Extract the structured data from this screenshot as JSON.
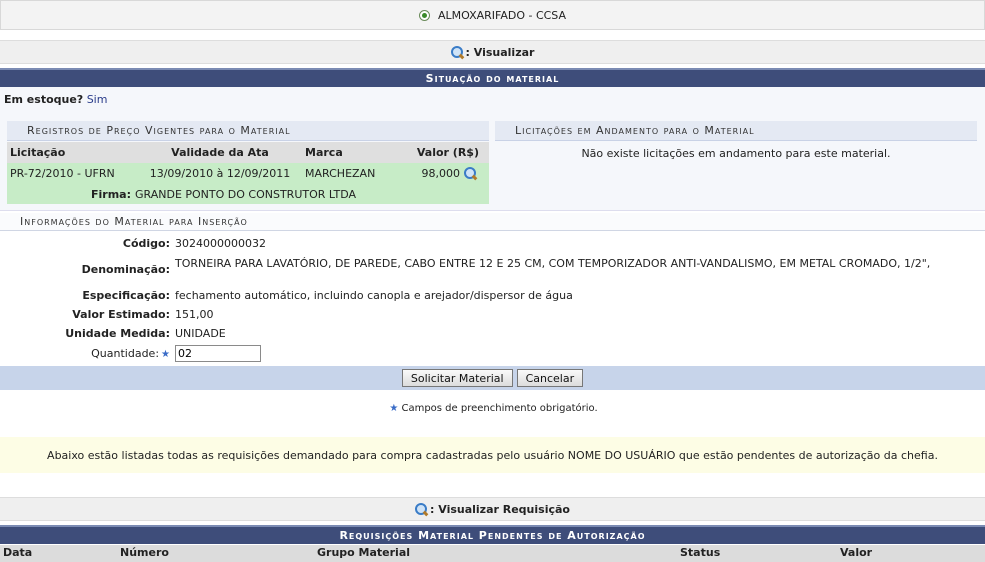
{
  "top": {
    "unit_label": "ALMOXARIFADO - CCSA"
  },
  "legend": {
    "view_label": ": Visualizar"
  },
  "situation": {
    "caption": "Situação do material",
    "stock_label": "Em estoque?",
    "stock_value": "Sim",
    "price_registry": {
      "title": "Registros de Preço Vigentes para o Material",
      "columns": [
        "Licitação",
        "Validade da Ata",
        "Marca",
        "Valor (R$)"
      ],
      "rows": [
        {
          "licitacao": "PR-72/2010 - UFRN",
          "validade": "13/09/2010 à 12/09/2011",
          "marca": "MARCHEZAN",
          "valor": "98,000"
        }
      ],
      "firm_label": "Firma:",
      "firm_value": "GRANDE PONTO DO CONSTRUTOR LTDA"
    },
    "bids": {
      "title": "Licitações em Andamento para o Material",
      "empty_message": "Não existe licitações em andamento para este material."
    }
  },
  "info": {
    "title": "Informações do Material para Inserção",
    "fields": [
      {
        "label": "Código:",
        "value": "3024000000032"
      },
      {
        "label": "Denominação:",
        "value": "TORNEIRA PARA LAVATÓRIO, DE PAREDE, CABO ENTRE 12 E 25 CM, COM TEMPORIZADOR ANTI-VANDALISMO, EM METAL CROMADO, 1/2\","
      },
      {
        "label": "Especificação:",
        "value": "fechamento automático, incluindo canopla e arejador/dispersor de água"
      },
      {
        "label": "Valor Estimado:",
        "value": "151,00"
      },
      {
        "label": "Unidade Medida:",
        "value": "UNIDADE"
      }
    ],
    "quantity_label": "Quantidade:",
    "quantity_value": "02"
  },
  "buttons": {
    "request": "Solicitar Material",
    "cancel": "Cancelar"
  },
  "required_note": "Campos de preenchimento obrigatório.",
  "notice": "Abaixo estão listadas todas as requisições demandado para compra cadastradas pelo usuário NOME DO USUÁRIO que estão pendentes de autorização da chefia.",
  "legend2": {
    "view_label": ": Visualizar Requisição"
  },
  "pending": {
    "caption": "Requisições Material Pendentes de Autorização",
    "columns": [
      "Data",
      "Número",
      "Grupo Material",
      "Status",
      "Valor"
    ]
  },
  "colors": {
    "header_bg": "#3e4d7a",
    "row_green": "#c7ecc7",
    "button_bar": "#c7d4ea",
    "notice_bg": "#fdfde5"
  }
}
